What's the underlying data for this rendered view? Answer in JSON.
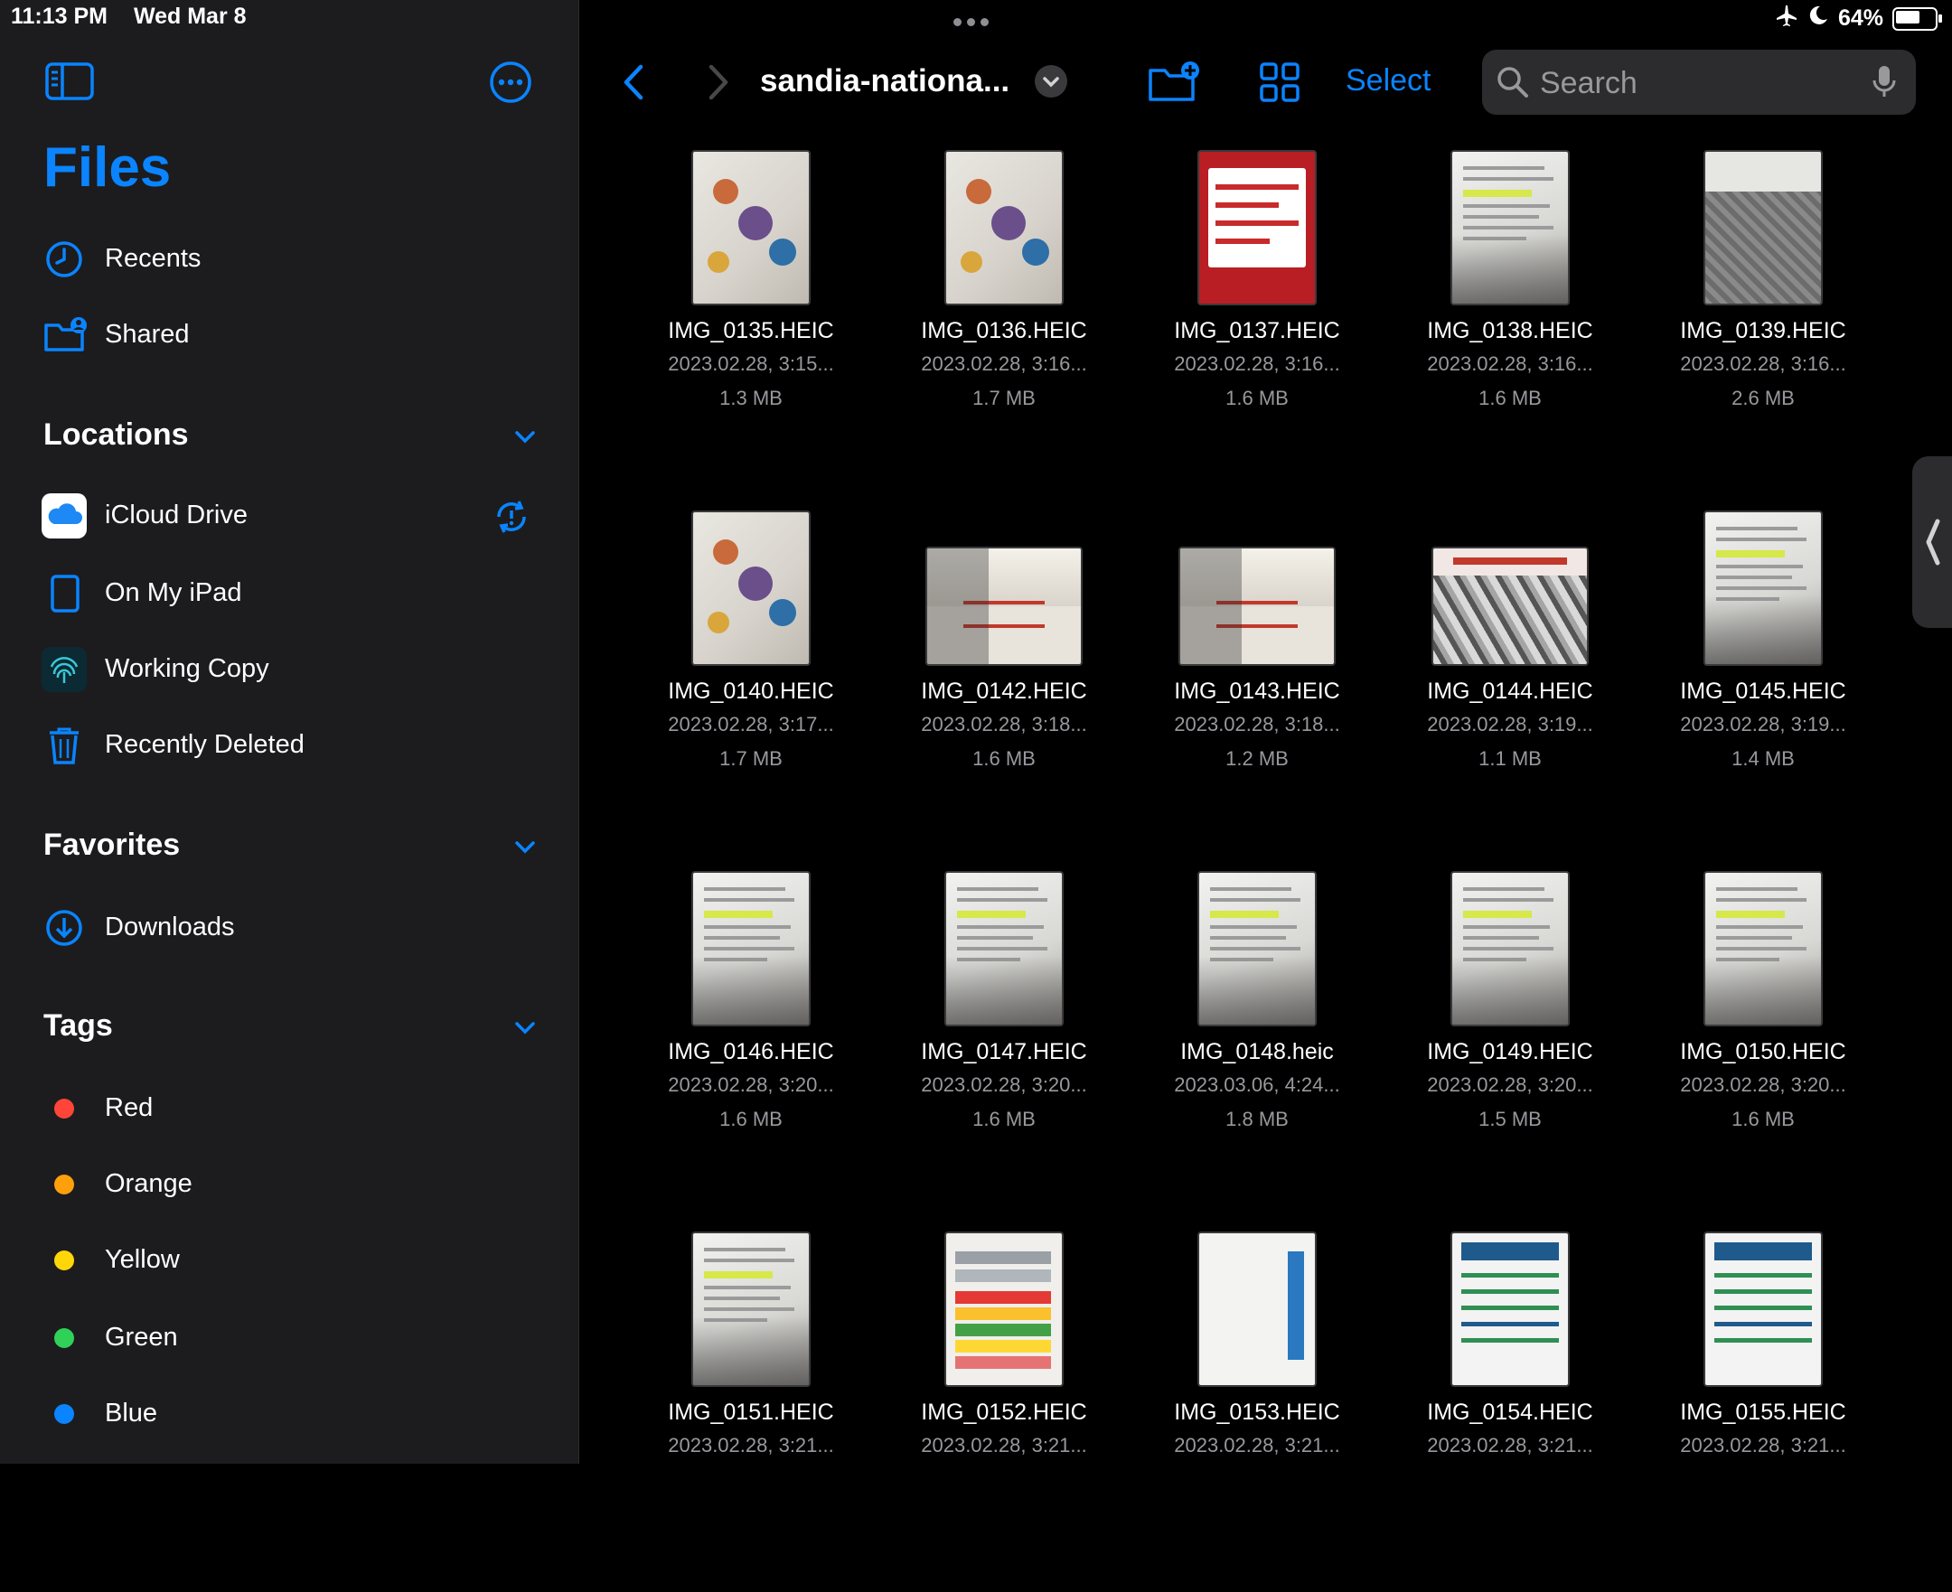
{
  "status": {
    "time": "11:13 PM",
    "date": "Wed Mar 8",
    "battery": "64%",
    "battery_level": 0.64
  },
  "sidebar": {
    "title": "Files",
    "top_items": [
      {
        "label": "Recents",
        "icon": "clock-icon"
      },
      {
        "label": "Shared",
        "icon": "shared-folder-icon"
      }
    ],
    "locations": {
      "heading": "Locations",
      "items": [
        {
          "label": "iCloud Drive",
          "icon": "icloud-icon"
        },
        {
          "label": "On My iPad",
          "icon": "ipad-icon"
        },
        {
          "label": "Working Copy",
          "icon": "fingerprint-icon"
        },
        {
          "label": "Recently Deleted",
          "icon": "trash-icon"
        }
      ]
    },
    "favorites": {
      "heading": "Favorites",
      "items": [
        {
          "label": "Downloads",
          "icon": "download-icon"
        }
      ]
    },
    "tags": {
      "heading": "Tags",
      "items": [
        {
          "label": "Red",
          "color": "#ff453a"
        },
        {
          "label": "Orange",
          "color": "#ff9f0a"
        },
        {
          "label": "Yellow",
          "color": "#ffd60a"
        },
        {
          "label": "Green",
          "color": "#30d158"
        },
        {
          "label": "Blue",
          "color": "#0a84ff"
        }
      ]
    }
  },
  "toolbar": {
    "folder_title": "sandia-nationa...",
    "select_label": "Select",
    "search_placeholder": "Search"
  },
  "files": [
    {
      "name": "IMG_0135.HEIC",
      "date": "2023.02.28, 3:15...",
      "size": "1.3 MB",
      "thumb": "booklet",
      "orientation": "portrait"
    },
    {
      "name": "IMG_0136.HEIC",
      "date": "2023.02.28, 3:16...",
      "size": "1.7 MB",
      "thumb": "booklet",
      "orientation": "portrait"
    },
    {
      "name": "IMG_0137.HEIC",
      "date": "2023.02.28, 3:16...",
      "size": "1.6 MB",
      "thumb": "red",
      "orientation": "portrait"
    },
    {
      "name": "IMG_0138.HEIC",
      "date": "2023.02.28, 3:16...",
      "size": "1.6 MB",
      "thumb": "doc",
      "orientation": "portrait"
    },
    {
      "name": "IMG_0139.HEIC",
      "date": "2023.02.28, 3:16...",
      "size": "2.6 MB",
      "thumb": "pattern",
      "orientation": "portrait"
    },
    {
      "name": "IMG_0140.HEIC",
      "date": "2023.02.28, 3:17...",
      "size": "1.7 MB",
      "thumb": "booklet",
      "orientation": "portrait"
    },
    {
      "name": "IMG_0142.HEIC",
      "date": "2023.02.28, 3:18...",
      "size": "1.6 MB",
      "thumb": "env",
      "orientation": "landscape"
    },
    {
      "name": "IMG_0143.HEIC",
      "date": "2023.02.28, 3:18...",
      "size": "1.2 MB",
      "thumb": "env",
      "orientation": "landscape"
    },
    {
      "name": "IMG_0144.HEIC",
      "date": "2023.02.28, 3:19...",
      "size": "1.1 MB",
      "thumb": "bw",
      "orientation": "landscape"
    },
    {
      "name": "IMG_0145.HEIC",
      "date": "2023.02.28, 3:19...",
      "size": "1.4 MB",
      "thumb": "doc",
      "orientation": "portrait"
    },
    {
      "name": "IMG_0146.HEIC",
      "date": "2023.02.28, 3:20...",
      "size": "1.6 MB",
      "thumb": "doc",
      "orientation": "portrait"
    },
    {
      "name": "IMG_0147.HEIC",
      "date": "2023.02.28, 3:20...",
      "size": "1.6 MB",
      "thumb": "doc",
      "orientation": "portrait"
    },
    {
      "name": "IMG_0148.heic",
      "date": "2023.03.06, 4:24...",
      "size": "1.8 MB",
      "thumb": "doc",
      "orientation": "portrait"
    },
    {
      "name": "IMG_0149.HEIC",
      "date": "2023.02.28, 3:20...",
      "size": "1.5 MB",
      "thumb": "doc",
      "orientation": "portrait"
    },
    {
      "name": "IMG_0150.HEIC",
      "date": "2023.02.28, 3:20...",
      "size": "1.6 MB",
      "thumb": "doc",
      "orientation": "portrait"
    },
    {
      "name": "IMG_0151.HEIC",
      "date": "2023.02.28, 3:21...",
      "size": "",
      "thumb": "doc",
      "orientation": "portrait"
    },
    {
      "name": "IMG_0152.HEIC",
      "date": "2023.02.28, 3:21...",
      "size": "",
      "thumb": "chart",
      "orientation": "portrait"
    },
    {
      "name": "IMG_0153.HEIC",
      "date": "2023.02.28, 3:21...",
      "size": "",
      "thumb": "blue",
      "orientation": "portrait"
    },
    {
      "name": "IMG_0154.HEIC",
      "date": "2023.02.28, 3:21...",
      "size": "",
      "thumb": "green",
      "orientation": "portrait"
    },
    {
      "name": "IMG_0155.HEIC",
      "date": "2023.02.28, 3:21...",
      "size": "",
      "thumb": "green",
      "orientation": "portrait"
    }
  ],
  "colors": {
    "accent": "#0a84ff",
    "sidebar_bg": "#1c1c1e",
    "main_bg": "#000000",
    "secondary_text": "#98989d"
  }
}
